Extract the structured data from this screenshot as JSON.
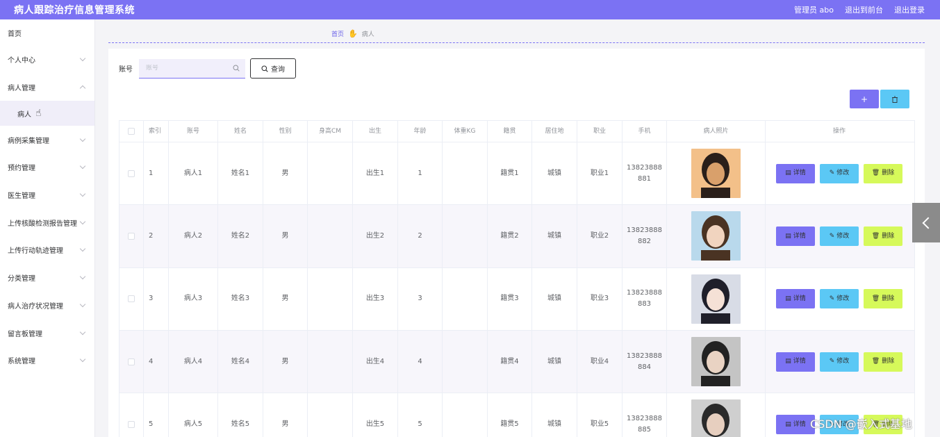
{
  "header": {
    "title": "病人跟踪治疗信息管理系统",
    "user": "管理员 abo",
    "front": "退出到前台",
    "logout": "退出登录"
  },
  "sidebar": {
    "items": [
      {
        "label": "首页"
      },
      {
        "label": "个人中心"
      },
      {
        "label": "病人管理"
      },
      {
        "label": "病人"
      },
      {
        "label": "病例采集管理"
      },
      {
        "label": "预约管理"
      },
      {
        "label": "医生管理"
      },
      {
        "label": "上传核酸检测报告管理"
      },
      {
        "label": "上传行动轨迹管理"
      },
      {
        "label": "分类管理"
      },
      {
        "label": "病人治疗状况管理"
      },
      {
        "label": "留言板管理"
      },
      {
        "label": "系统管理"
      }
    ]
  },
  "breadcrumb": {
    "home": "首页",
    "current": "病人"
  },
  "search": {
    "label": "账号",
    "placeholder": "账号",
    "button": "查询"
  },
  "toolbar": {
    "add": "+"
  },
  "table": {
    "headers": [
      "索引",
      "账号",
      "姓名",
      "性别",
      "身高CM",
      "出生",
      "年龄",
      "体重KG",
      "籍贯",
      "居住地",
      "职业",
      "手机",
      "病人照片",
      "操作"
    ],
    "rows": [
      {
        "idx": "1",
        "acct": "病人1",
        "name": "姓名1",
        "sex": "男",
        "height": "",
        "birth": "出生1",
        "age": "1",
        "weight": "",
        "origin": "籍贯1",
        "residence": "城镇",
        "job": "职业1",
        "phone1": "13823888",
        "phone2": "881"
      },
      {
        "idx": "2",
        "acct": "病人2",
        "name": "姓名2",
        "sex": "男",
        "height": "",
        "birth": "出生2",
        "age": "2",
        "weight": "",
        "origin": "籍贯2",
        "residence": "城镇",
        "job": "职业2",
        "phone1": "13823888",
        "phone2": "882"
      },
      {
        "idx": "3",
        "acct": "病人3",
        "name": "姓名3",
        "sex": "男",
        "height": "",
        "birth": "出生3",
        "age": "3",
        "weight": "",
        "origin": "籍贯3",
        "residence": "城镇",
        "job": "职业3",
        "phone1": "13823888",
        "phone2": "883"
      },
      {
        "idx": "4",
        "acct": "病人4",
        "name": "姓名4",
        "sex": "男",
        "height": "",
        "birth": "出生4",
        "age": "4",
        "weight": "",
        "origin": "籍贯4",
        "residence": "城镇",
        "job": "职业4",
        "phone1": "13823888",
        "phone2": "884"
      },
      {
        "idx": "5",
        "acct": "病人5",
        "name": "姓名5",
        "sex": "男",
        "height": "",
        "birth": "出生5",
        "age": "5",
        "weight": "",
        "origin": "籍贯5",
        "residence": "城镇",
        "job": "职业5",
        "phone1": "13823888",
        "phone2": "885"
      }
    ],
    "ops": {
      "detail": "详情",
      "edit": "修改",
      "remove": "删除"
    }
  },
  "watermark": "CSDN @嵌入式基地",
  "colors": {
    "primary": "#7b72f3",
    "info": "#5bc8f5",
    "warn": "#d6f95a"
  }
}
